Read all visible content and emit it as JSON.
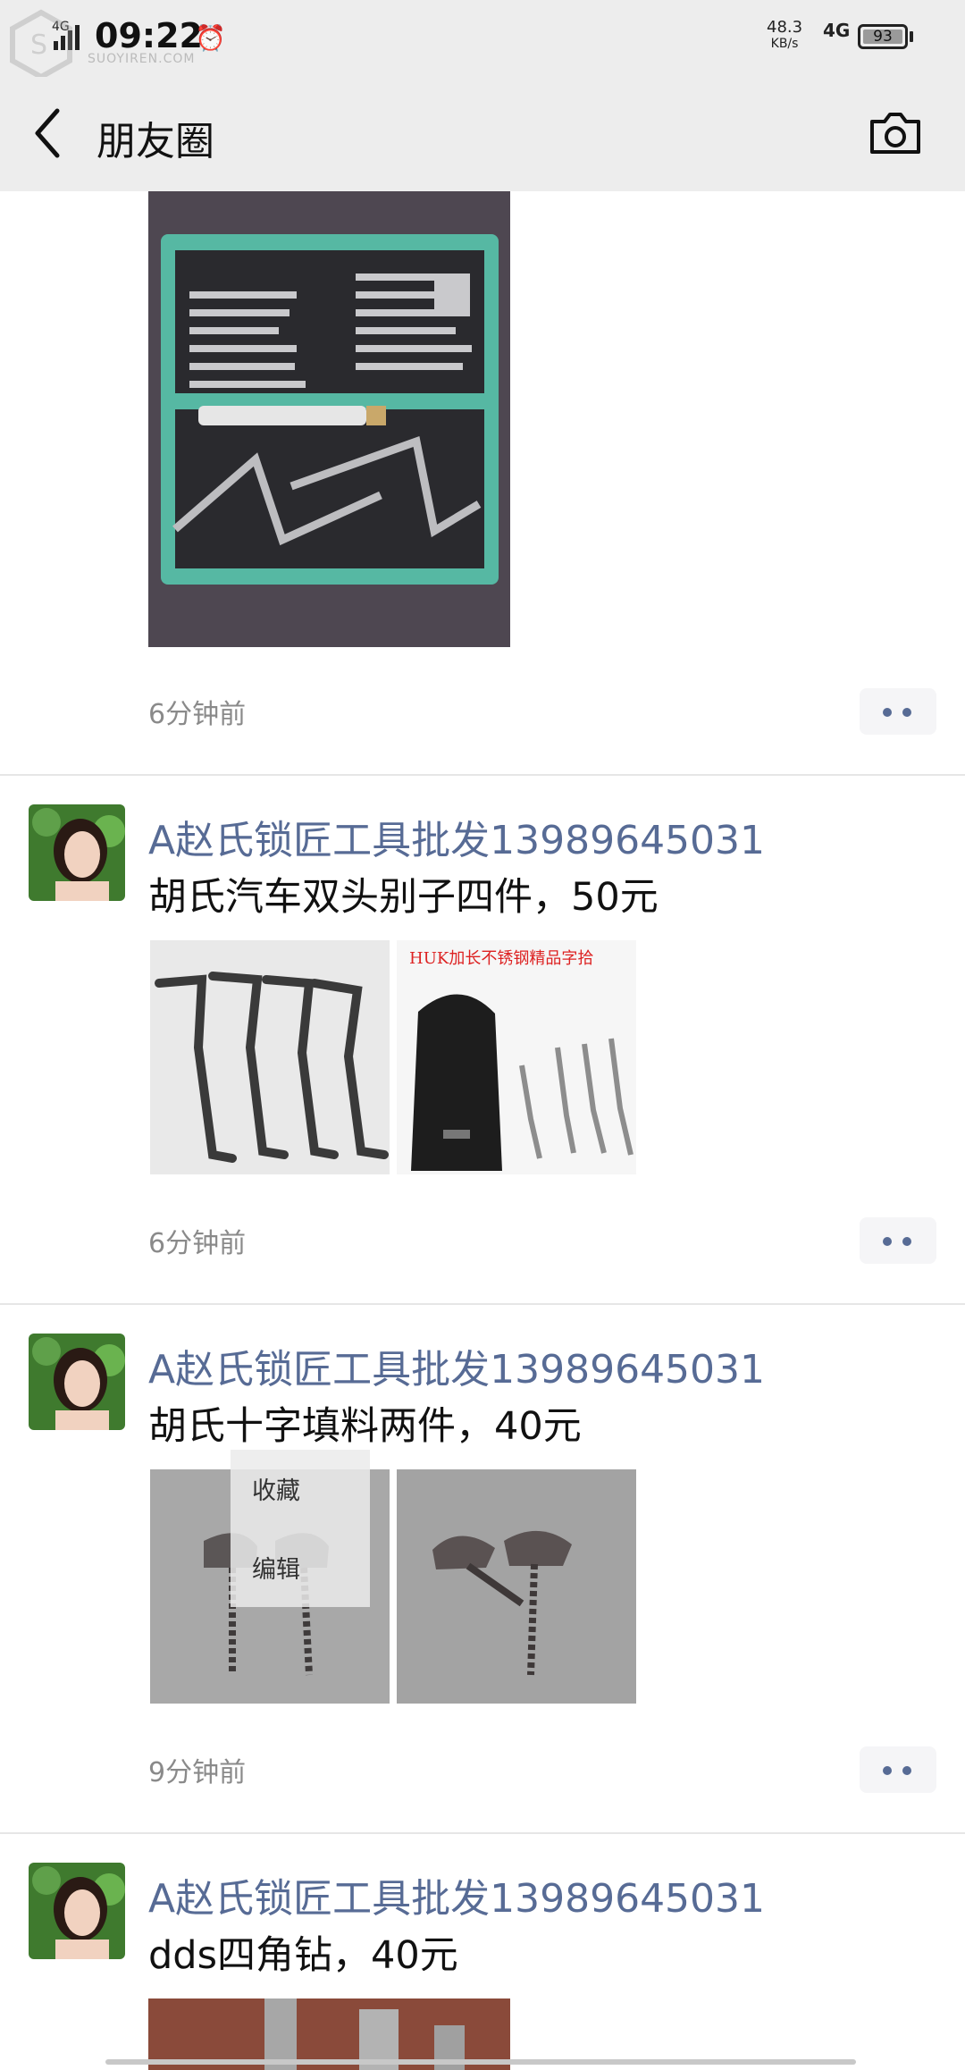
{
  "status_bar": {
    "network_small": "4G",
    "time": "09:22",
    "speed_value": "48.3",
    "speed_unit": "KB/s",
    "network": "4G",
    "battery": "93",
    "watermark": "SUOYIREN.COM"
  },
  "nav": {
    "title": "朋友圈",
    "back_icon": "chevron-left-icon",
    "camera_icon": "camera-icon"
  },
  "posts": [
    {
      "time": "6分钟前",
      "images": [
        "green-lockpick-case"
      ]
    },
    {
      "user": "A赵氏锁匠工具批发13989645031",
      "text": "胡氏汽车双头别子四件，50元",
      "time": "6分钟前",
      "images": [
        "tension-wrenches",
        "huk-pouch-tools"
      ],
      "image_caption": "HUK加长不锈钢精品字拾"
    },
    {
      "user": "A赵氏锁匠工具批发13989645031",
      "text": "胡氏十字填料两件，40元",
      "time": "9分钟前",
      "images": [
        "cross-keys-1",
        "cross-keys-2"
      ]
    },
    {
      "user": "A赵氏锁匠工具批发13989645031",
      "text": "dds四角钻，40元",
      "images": [
        "drill-bits"
      ]
    }
  ],
  "popup": {
    "items": [
      "收藏",
      "编辑"
    ]
  },
  "colors": {
    "username": "#576b95",
    "bar_bg": "#ededed",
    "time_text": "#8a8a8a"
  }
}
